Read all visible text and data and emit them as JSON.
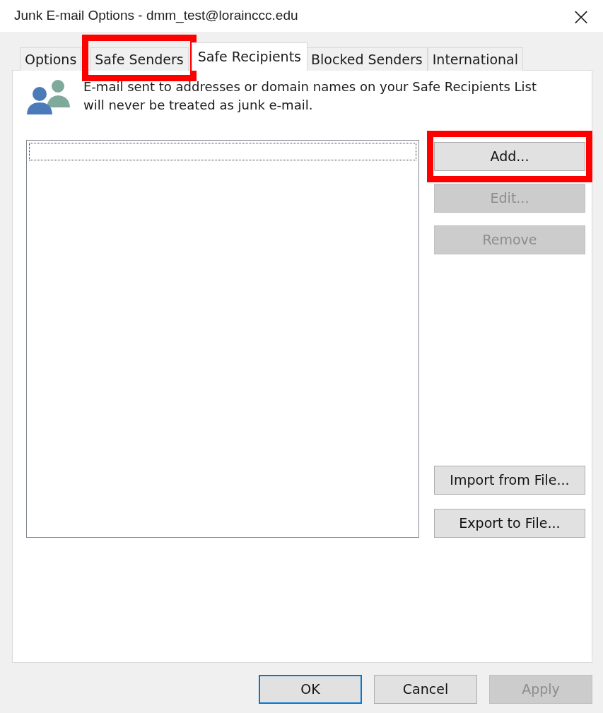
{
  "window": {
    "title": "Junk E-mail Options - dmm_test@lorainccc.edu",
    "close": "×"
  },
  "tabs": [
    {
      "label": "Options",
      "selected": false,
      "highlighted": false
    },
    {
      "label": "Safe Senders",
      "selected": false,
      "highlighted": true
    },
    {
      "label": "Safe Recipients",
      "selected": true,
      "highlighted": false
    },
    {
      "label": "Blocked Senders",
      "selected": false,
      "highlighted": false
    },
    {
      "label": "International",
      "selected": false,
      "highlighted": false
    }
  ],
  "description": "E-mail sent to addresses or domain names on your Safe Recipients List will never be treated as junk e-mail.",
  "list_buttons": [
    {
      "label": "Add...",
      "disabled": false,
      "highlighted": true
    },
    {
      "label": "Edit...",
      "disabled": true,
      "highlighted": false
    },
    {
      "label": "Remove",
      "disabled": true,
      "highlighted": false
    }
  ],
  "file_buttons": [
    {
      "label": "Import from File...",
      "disabled": false
    },
    {
      "label": "Export to File...",
      "disabled": false
    }
  ],
  "dialog_buttons": [
    {
      "label": "OK",
      "disabled": false,
      "default": true
    },
    {
      "label": "Cancel",
      "disabled": false,
      "default": false
    },
    {
      "label": "Apply",
      "disabled": true,
      "default": false
    }
  ]
}
